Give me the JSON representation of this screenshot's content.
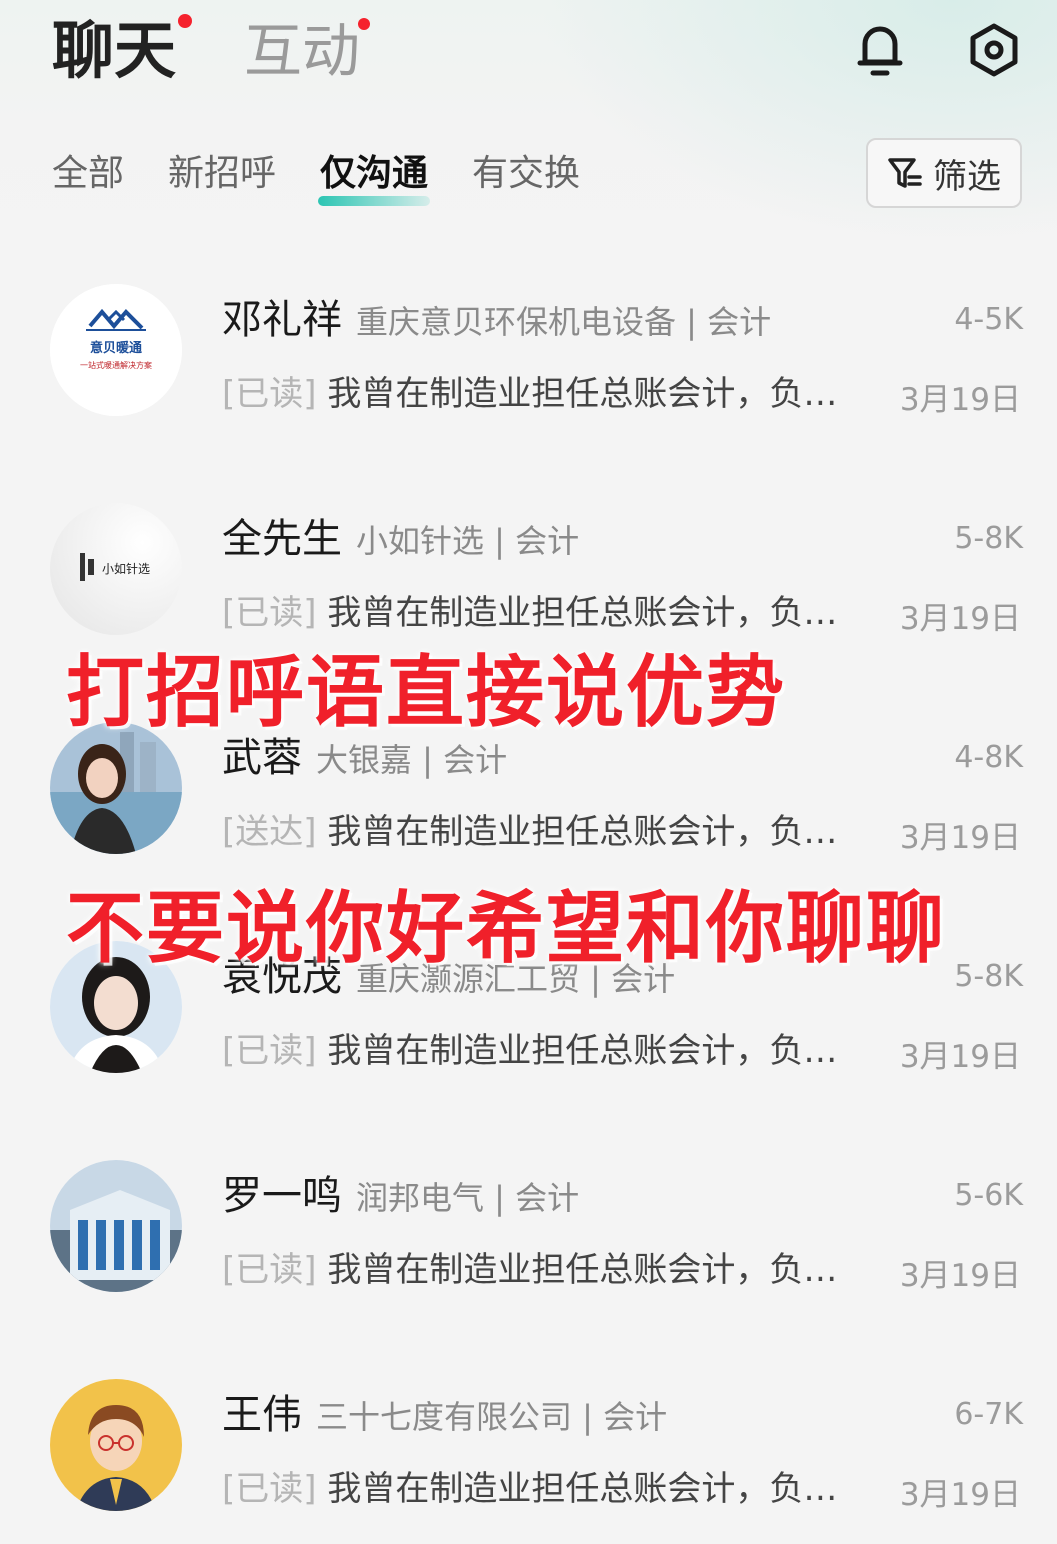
{
  "header": {
    "tabs": [
      {
        "label": "聊天",
        "badge": true
      },
      {
        "label": "互动",
        "badge": true
      }
    ]
  },
  "subtabs": [
    "全部",
    "新招呼",
    "仅沟通",
    "有交换"
  ],
  "active_subtab": "仅沟通",
  "filter_label": "筛选",
  "chats": [
    {
      "name": "邓礼祥",
      "company": "重庆意贝环保机电设备 | 会计",
      "salary": "4-5K",
      "status": "[已读]",
      "message": "我曾在制造业担任总账会计，负…",
      "time": "3月19日",
      "avatar_text": "意贝暖通",
      "avatar_subtext": "一站式暖通解决方案"
    },
    {
      "name": "全先生",
      "company": "小如针选 | 会计",
      "salary": "5-8K",
      "status": "[已读]",
      "message": "我曾在制造业担任总账会计，负…",
      "time": "3月19日",
      "avatar_text": "小如针选"
    },
    {
      "name": "武蓉",
      "company": "大银嘉 | 会计",
      "salary": "4-8K",
      "status": "[送达]",
      "message": "我曾在制造业担任总账会计，负…",
      "time": "3月19日"
    },
    {
      "name": "袁悦茂",
      "company": "重庆灏源汇工贸 | 会计",
      "salary": "5-8K",
      "status": "[已读]",
      "message": "我曾在制造业担任总账会计，负…",
      "time": "3月19日"
    },
    {
      "name": "罗一鸣",
      "company": "润邦电气 | 会计",
      "salary": "5-6K",
      "status": "[已读]",
      "message": "我曾在制造业担任总账会计，负…",
      "time": "3月19日"
    },
    {
      "name": "王伟",
      "company": "三十七度有限公司 | 会计",
      "salary": "6-7K",
      "status": "[已读]",
      "message": "我曾在制造业担任总账会计，负…",
      "time": "3月19日"
    }
  ],
  "overlays": {
    "line1": "打招呼语直接说优势",
    "line2": "不要说你好希望和你聊聊"
  },
  "colors": {
    "accent": "#2cc5b3",
    "overlay": "#f0202a",
    "badge": "#f5222d"
  }
}
